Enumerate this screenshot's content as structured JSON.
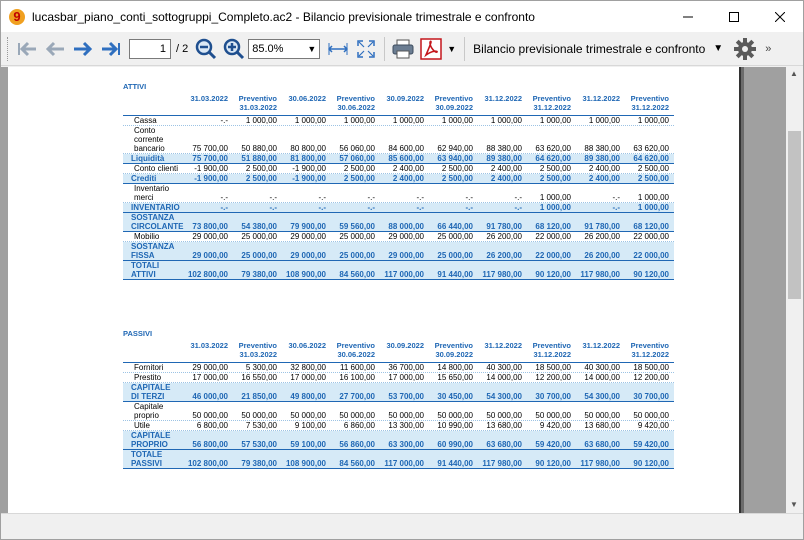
{
  "window": {
    "title": "lucasbar_piano_conti_sottogruppi_Completo.ac2 - Bilancio previsionale trimestrale e confronto"
  },
  "toolbar": {
    "page_current": "1",
    "page_total": "/ 2",
    "zoom": "85.0%",
    "report_name": "Bilancio previsionale trimestrale e confronto"
  },
  "columns": [
    [
      "31.03.2022",
      ""
    ],
    [
      "Preventivo",
      "31.03.2022"
    ],
    [
      "30.06.2022",
      ""
    ],
    [
      "Preventivo",
      "30.06.2022"
    ],
    [
      "30.09.2022",
      ""
    ],
    [
      "Preventivo",
      "30.09.2022"
    ],
    [
      "31.12.2022",
      ""
    ],
    [
      "Preventivo",
      "31.12.2022"
    ],
    [
      "31.12.2022",
      ""
    ],
    [
      "Preventivo",
      "31.12.2022"
    ]
  ],
  "attivi": {
    "title": "ATTIVI",
    "rows": [
      {
        "label": [
          "Cassa"
        ],
        "total": false,
        "values": [
          "-.-",
          "1 000,00",
          "1 000,00",
          "1 000,00",
          "1 000,00",
          "1 000,00",
          "1 000,00",
          "1 000,00",
          "1 000,00",
          "1 000,00"
        ]
      },
      {
        "label": [
          "Conto",
          "corrente",
          "bancario"
        ],
        "total": false,
        "values": [
          "75 700,00",
          "50 880,00",
          "80 800,00",
          "56 060,00",
          "84 600,00",
          "62 940,00",
          "88 380,00",
          "63 620,00",
          "88 380,00",
          "63 620,00"
        ]
      },
      {
        "label": [
          "Liquidità"
        ],
        "total": true,
        "values": [
          "75 700,00",
          "51 880,00",
          "81 800,00",
          "57 060,00",
          "85 600,00",
          "63 940,00",
          "89 380,00",
          "64 620,00",
          "89 380,00",
          "64 620,00"
        ]
      },
      {
        "label": [
          "Conto clienti"
        ],
        "total": false,
        "values": [
          "-1 900,00",
          "2 500,00",
          "-1 900,00",
          "2 500,00",
          "2 400,00",
          "2 500,00",
          "2 400,00",
          "2 500,00",
          "2 400,00",
          "2 500,00"
        ]
      },
      {
        "label": [
          "Crediti"
        ],
        "total": true,
        "values": [
          "-1 900,00",
          "2 500,00",
          "-1 900,00",
          "2 500,00",
          "2 400,00",
          "2 500,00",
          "2 400,00",
          "2 500,00",
          "2 400,00",
          "2 500,00"
        ]
      },
      {
        "label": [
          "Inventario",
          "merci"
        ],
        "total": false,
        "values": [
          "-.-",
          "-.-",
          "-.-",
          "-.-",
          "-.-",
          "-.-",
          "-.-",
          "1 000,00",
          "-.-",
          "1 000,00"
        ]
      },
      {
        "label": [
          "INVENTARIO"
        ],
        "total": true,
        "values": [
          "-.-",
          "-.-",
          "-.-",
          "-.-",
          "-.-",
          "-.-",
          "-.-",
          "1 000,00",
          "-.-",
          "1 000,00"
        ]
      },
      {
        "label": [
          "SOSTANZA",
          "CIRCOLANTE"
        ],
        "total": true,
        "values": [
          "73 800,00",
          "54 380,00",
          "79 900,00",
          "59 560,00",
          "88 000,00",
          "66 440,00",
          "91 780,00",
          "68 120,00",
          "91 780,00",
          "68 120,00"
        ]
      },
      {
        "label": [
          "Mobilio"
        ],
        "total": false,
        "values": [
          "29 000,00",
          "25 000,00",
          "29 000,00",
          "25 000,00",
          "29 000,00",
          "25 000,00",
          "26 200,00",
          "22 000,00",
          "26 200,00",
          "22 000,00"
        ]
      },
      {
        "label": [
          "SOSTANZA",
          "FISSA"
        ],
        "total": true,
        "values": [
          "29 000,00",
          "25 000,00",
          "29 000,00",
          "25 000,00",
          "29 000,00",
          "25 000,00",
          "26 200,00",
          "22 000,00",
          "26 200,00",
          "22 000,00"
        ]
      },
      {
        "label": [
          "TOTALI",
          "ATTIVI"
        ],
        "total": true,
        "values": [
          "102 800,00",
          "79 380,00",
          "108 900,00",
          "84 560,00",
          "117 000,00",
          "91 440,00",
          "117 980,00",
          "90 120,00",
          "117 980,00",
          "90 120,00"
        ]
      }
    ]
  },
  "passivi": {
    "title": "PASSIVI",
    "rows": [
      {
        "label": [
          "Fornitori"
        ],
        "total": false,
        "values": [
          "29 000,00",
          "5 300,00",
          "32 800,00",
          "11 600,00",
          "36 700,00",
          "14 800,00",
          "40 300,00",
          "18 500,00",
          "40 300,00",
          "18 500,00"
        ]
      },
      {
        "label": [
          "Prestito"
        ],
        "total": false,
        "values": [
          "17 000,00",
          "16 550,00",
          "17 000,00",
          "16 100,00",
          "17 000,00",
          "15 650,00",
          "14 000,00",
          "12 200,00",
          "14 000,00",
          "12 200,00"
        ]
      },
      {
        "label": [
          "CAPITALE",
          "DI TERZI"
        ],
        "total": true,
        "values": [
          "46 000,00",
          "21 850,00",
          "49 800,00",
          "27 700,00",
          "53 700,00",
          "30 450,00",
          "54 300,00",
          "30 700,00",
          "54 300,00",
          "30 700,00"
        ]
      },
      {
        "label": [
          "Capitale",
          "proprio"
        ],
        "total": false,
        "values": [
          "50 000,00",
          "50 000,00",
          "50 000,00",
          "50 000,00",
          "50 000,00",
          "50 000,00",
          "50 000,00",
          "50 000,00",
          "50 000,00",
          "50 000,00"
        ]
      },
      {
        "label": [
          "Utile"
        ],
        "total": false,
        "values": [
          "6 800,00",
          "7 530,00",
          "9 100,00",
          "6 860,00",
          "13 300,00",
          "10 990,00",
          "13 680,00",
          "9 420,00",
          "13 680,00",
          "9 420,00"
        ]
      },
      {
        "label": [
          "CAPITALE",
          "PROPRIO"
        ],
        "total": true,
        "values": [
          "56 800,00",
          "57 530,00",
          "59 100,00",
          "56 860,00",
          "63 300,00",
          "60 990,00",
          "63 680,00",
          "59 420,00",
          "63 680,00",
          "59 420,00"
        ]
      },
      {
        "label": [
          "TOTALE",
          "PASSIVI"
        ],
        "total": true,
        "values": [
          "102 800,00",
          "79 380,00",
          "108 900,00",
          "84 560,00",
          "117 000,00",
          "91 440,00",
          "117 980,00",
          "90 120,00",
          "117 980,00",
          "90 120,00"
        ]
      }
    ]
  }
}
